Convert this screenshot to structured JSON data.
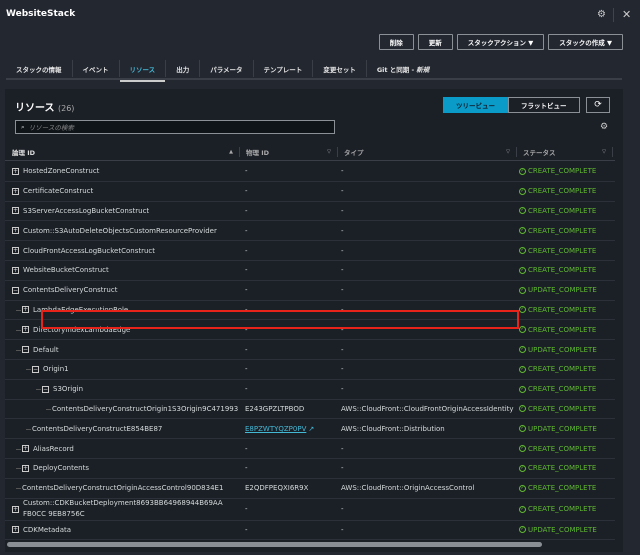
{
  "window": {
    "title": "WebsiteStack"
  },
  "actions": [
    "削除",
    "更新",
    "スタックアクション ▼",
    "スタックの作成 ▼"
  ],
  "tabs": [
    {
      "label": "スタックの情報"
    },
    {
      "label": "イベント"
    },
    {
      "label": "リソース",
      "active": true
    },
    {
      "label": "出力"
    },
    {
      "label": "パラメータ"
    },
    {
      "label": "テンプレート"
    },
    {
      "label": "変更セット"
    },
    {
      "label": "Git と同期 -",
      "badge": "新規"
    }
  ],
  "panel": {
    "title": "リソース",
    "count": "(26)",
    "view_tree": "ツリービュー",
    "view_flat": "フラットビュー",
    "search_placeholder": "リソースの検索"
  },
  "columns": [
    "論理 ID",
    "物理 ID",
    "タイプ",
    "ステータス"
  ],
  "colors": {
    "accent": "#0a9bc9",
    "success": "#5fb832",
    "highlight": "#e8231a"
  },
  "rows": [
    {
      "id": "HostedZoneConstruct",
      "level": 0,
      "exp": "+",
      "physical": "-",
      "type": "-",
      "status": "CREATE_COMPLETE"
    },
    {
      "id": "CertificateConstruct",
      "level": 0,
      "exp": "+",
      "physical": "-",
      "type": "-",
      "status": "CREATE_COMPLETE"
    },
    {
      "id": "S3ServerAccessLogBucketConstruct",
      "level": 0,
      "exp": "+",
      "physical": "-",
      "type": "-",
      "status": "CREATE_COMPLETE"
    },
    {
      "id": "Custom::S3AutoDeleteObjectsCustomResourceProvider",
      "level": 0,
      "exp": "+",
      "physical": "-",
      "type": "-",
      "status": "CREATE_COMPLETE"
    },
    {
      "id": "CloudFrontAccessLogBucketConstruct",
      "level": 0,
      "exp": "+",
      "physical": "-",
      "type": "-",
      "status": "CREATE_COMPLETE"
    },
    {
      "id": "WebsiteBucketConstruct",
      "level": 0,
      "exp": "+",
      "physical": "-",
      "type": "-",
      "status": "CREATE_COMPLETE"
    },
    {
      "id": "ContentsDeliveryConstruct",
      "level": 0,
      "exp": "-",
      "physical": "-",
      "type": "-",
      "status": "UPDATE_COMPLETE"
    },
    {
      "id": "LambdaEdgeExecutionRole",
      "level": 1,
      "exp": "+",
      "physical": "-",
      "type": "-",
      "status": "CREATE_COMPLETE"
    },
    {
      "id": "DirectoryIndexLambdaEdge",
      "level": 1,
      "exp": "+",
      "physical": "-",
      "type": "-",
      "status": "CREATE_COMPLETE"
    },
    {
      "id": "Default",
      "level": 1,
      "exp": "-",
      "physical": "-",
      "type": "-",
      "status": "UPDATE_COMPLETE"
    },
    {
      "id": "Origin1",
      "level": 2,
      "exp": "-",
      "physical": "-",
      "type": "-",
      "status": "CREATE_COMPLETE"
    },
    {
      "id": "S3Origin",
      "level": 3,
      "exp": "-",
      "physical": "-",
      "type": "-",
      "status": "CREATE_COMPLETE"
    },
    {
      "id": "ContentsDeliveryConstructOrigin1S3Origin9C471993",
      "level": 4,
      "exp": "",
      "physical": "E243GPZLTPBOD",
      "type": "AWS::CloudFront::CloudFrontOriginAccessIdentity",
      "status": "CREATE_COMPLETE",
      "highlighted": true
    },
    {
      "id": "ContentsDeliveryConstructE854BE87",
      "level": 2,
      "exp": "",
      "physical": "E8PZWTYQZP0PV",
      "physical_link": true,
      "type": "AWS::CloudFront::Distribution",
      "status": "UPDATE_COMPLETE"
    },
    {
      "id": "AliasRecord",
      "level": 1,
      "exp": "+",
      "physical": "-",
      "type": "-",
      "status": "CREATE_COMPLETE"
    },
    {
      "id": "DeployContents",
      "level": 1,
      "exp": "+",
      "physical": "-",
      "type": "-",
      "status": "CREATE_COMPLETE"
    },
    {
      "id": "ContentsDeliveryConstructOriginAccessControl90D834E1",
      "level": 1,
      "exp": "",
      "physical": "E2QDFPEQXI6R9X",
      "type": "AWS::CloudFront::OriginAccessControl",
      "status": "CREATE_COMPLETE"
    },
    {
      "id": "Custom::CDKBucketDeployment8693BB64968944B69AAFB0CC 9EB8756C",
      "level": 0,
      "exp": "+",
      "physical": "-",
      "type": "-",
      "status": "CREATE_COMPLETE"
    },
    {
      "id": "CDKMetadata",
      "level": 0,
      "exp": "+",
      "physical": "-",
      "type": "-",
      "status": "UPDATE_COMPLETE"
    }
  ]
}
